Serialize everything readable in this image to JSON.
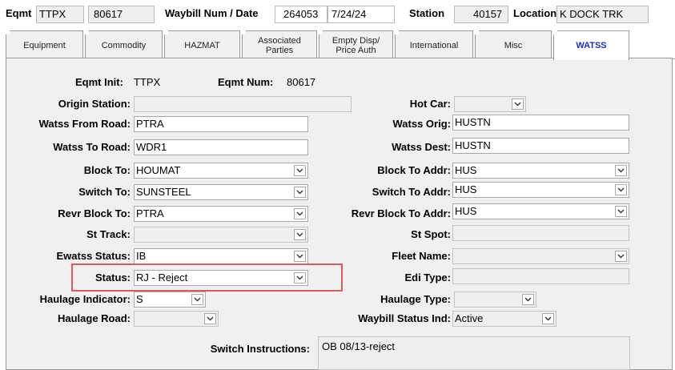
{
  "header": {
    "eqmt_label": "Eqmt",
    "eqmt_init": "TTPX",
    "eqmt_num": "80617",
    "waybill_label": "Waybill Num / Date",
    "waybill_num": "264053",
    "waybill_date": "7/24/24",
    "station_label": "Station",
    "station_num": "40157",
    "location_label": "Location",
    "location_value": "K DOCK TRK"
  },
  "tabs": [
    {
      "label": "Equipment"
    },
    {
      "label": "Commodity"
    },
    {
      "label": "HAZMAT"
    },
    {
      "label_line1": "Associated",
      "label_line2": "Parties"
    },
    {
      "label_line1": "Empty Disp/",
      "label_line2": "Price Auth"
    },
    {
      "label": "International"
    },
    {
      "label": "Misc"
    },
    {
      "label": "WATSS",
      "active": true
    }
  ],
  "form": {
    "eqmt_init_label": "Eqmt Init:",
    "eqmt_init_value": "TTPX",
    "eqmt_num_label": "Eqmt Num:",
    "eqmt_num_value": "80617",
    "left": {
      "origin_station": {
        "label": "Origin Station:",
        "value": ""
      },
      "watss_from_road": {
        "label": "Watss From Road:",
        "value": "PTRA"
      },
      "watss_to_road": {
        "label": "Watss To Road:",
        "value": "WDR1"
      },
      "block_to": {
        "label": "Block To:",
        "value": "HOUMAT"
      },
      "switch_to": {
        "label": "Switch To:",
        "value": "SUNSTEEL"
      },
      "revr_block_to": {
        "label": "Revr Block To:",
        "value": "PTRA"
      },
      "st_track": {
        "label": "St Track:",
        "value": ""
      },
      "ewatss_status": {
        "label": "Ewatss Status:",
        "value": "IB"
      },
      "status": {
        "label": "Status:",
        "value": "RJ - Reject"
      },
      "haulage_indicator": {
        "label": "Haulage Indicator:",
        "value": "S"
      },
      "haulage_road": {
        "label": "Haulage Road:",
        "value": ""
      }
    },
    "right": {
      "hot_car": {
        "label": "Hot Car:",
        "value": ""
      },
      "watss_orig": {
        "label": "Watss Orig:",
        "value": "HUSTN"
      },
      "watss_dest": {
        "label": "Watss Dest:",
        "value": "HUSTN"
      },
      "block_to_addr": {
        "label": "Block To Addr:",
        "value": "HUS"
      },
      "switch_to_addr": {
        "label": "Switch To Addr:",
        "value": "HUS"
      },
      "revr_block_to_addr": {
        "label": "Revr Block To Addr:",
        "value": "HUS"
      },
      "st_spot": {
        "label": "St Spot:",
        "value": ""
      },
      "fleet_name": {
        "label": "Fleet Name:",
        "value": ""
      },
      "edi_type": {
        "label": "Edi Type:",
        "value": ""
      },
      "haulage_type": {
        "label": "Haulage Type:",
        "value": ""
      },
      "waybill_status_ind": {
        "label": "Waybill Status Ind:",
        "value": "Active"
      }
    },
    "switch_instructions": {
      "label": "Switch Instructions:",
      "value": "OB 08/13-reject"
    }
  },
  "colors": {
    "highlight_box": "#e05a5a",
    "active_tab_text": "#1a2fc9"
  }
}
